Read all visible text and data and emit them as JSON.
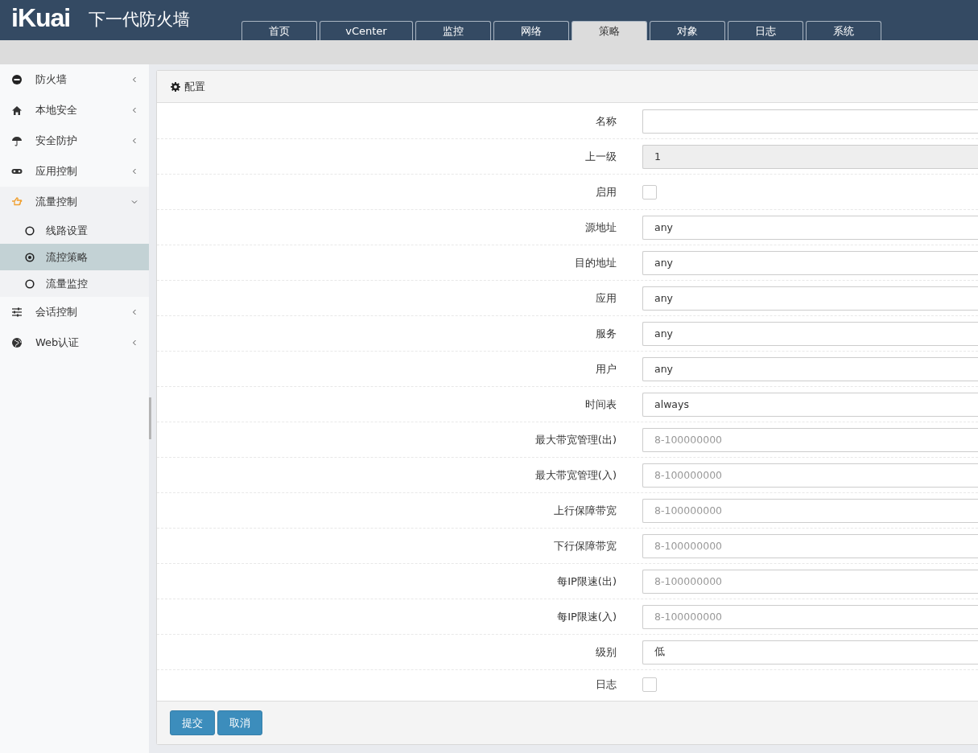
{
  "header": {
    "logo": "iKuai",
    "title": "下一代防火墙"
  },
  "tabs": [
    {
      "label": "首页",
      "selected": false
    },
    {
      "label": "vCenter",
      "selected": false
    },
    {
      "label": "监控",
      "selected": false
    },
    {
      "label": "网络",
      "selected": false
    },
    {
      "label": "策略",
      "selected": true
    },
    {
      "label": "对象",
      "selected": false
    },
    {
      "label": "日志",
      "selected": false
    },
    {
      "label": "系统",
      "selected": false
    }
  ],
  "sidebar": {
    "items": [
      {
        "label": "防火墙",
        "expanded": false
      },
      {
        "label": "本地安全",
        "expanded": false
      },
      {
        "label": "安全防护",
        "expanded": false
      },
      {
        "label": "应用控制",
        "expanded": false
      },
      {
        "label": "流量控制",
        "expanded": true,
        "children": [
          {
            "label": "线路设置",
            "selected": false
          },
          {
            "label": "流控策略",
            "selected": true
          },
          {
            "label": "流量监控",
            "selected": false
          }
        ]
      },
      {
        "label": "会话控制",
        "expanded": false
      },
      {
        "label": "Web认证",
        "expanded": false
      }
    ]
  },
  "panel": {
    "title": "配置",
    "fields": [
      {
        "label": "名称",
        "kind": "input"
      },
      {
        "label": "上一级",
        "kind": "input",
        "value": "1",
        "disabled": true
      },
      {
        "label": "启用",
        "kind": "checkbox",
        "checked": false
      },
      {
        "label": "源地址",
        "kind": "input",
        "value": "any"
      },
      {
        "label": "目的地址",
        "kind": "input",
        "value": "any"
      },
      {
        "label": "应用",
        "kind": "input",
        "value": "any"
      },
      {
        "label": "服务",
        "kind": "input",
        "value": "any"
      },
      {
        "label": "用户",
        "kind": "input",
        "value": "any"
      },
      {
        "label": "时间表",
        "kind": "input",
        "value": "always"
      },
      {
        "label": "最大带宽管理(出)",
        "kind": "input",
        "placeholder": "8-100000000"
      },
      {
        "label": "最大带宽管理(入)",
        "kind": "input",
        "placeholder": "8-100000000"
      },
      {
        "label": "上行保障带宽",
        "kind": "input",
        "placeholder": "8-100000000"
      },
      {
        "label": "下行保障带宽",
        "kind": "input",
        "placeholder": "8-100000000"
      },
      {
        "label": "每IP限速(出)",
        "kind": "input",
        "placeholder": "8-100000000"
      },
      {
        "label": "每IP限速(入)",
        "kind": "input",
        "placeholder": "8-100000000"
      },
      {
        "label": "级别",
        "kind": "input",
        "value": "低"
      },
      {
        "label": "日志",
        "kind": "checkbox",
        "checked": false
      }
    ],
    "buttons": [
      "提交",
      "取消"
    ]
  }
}
